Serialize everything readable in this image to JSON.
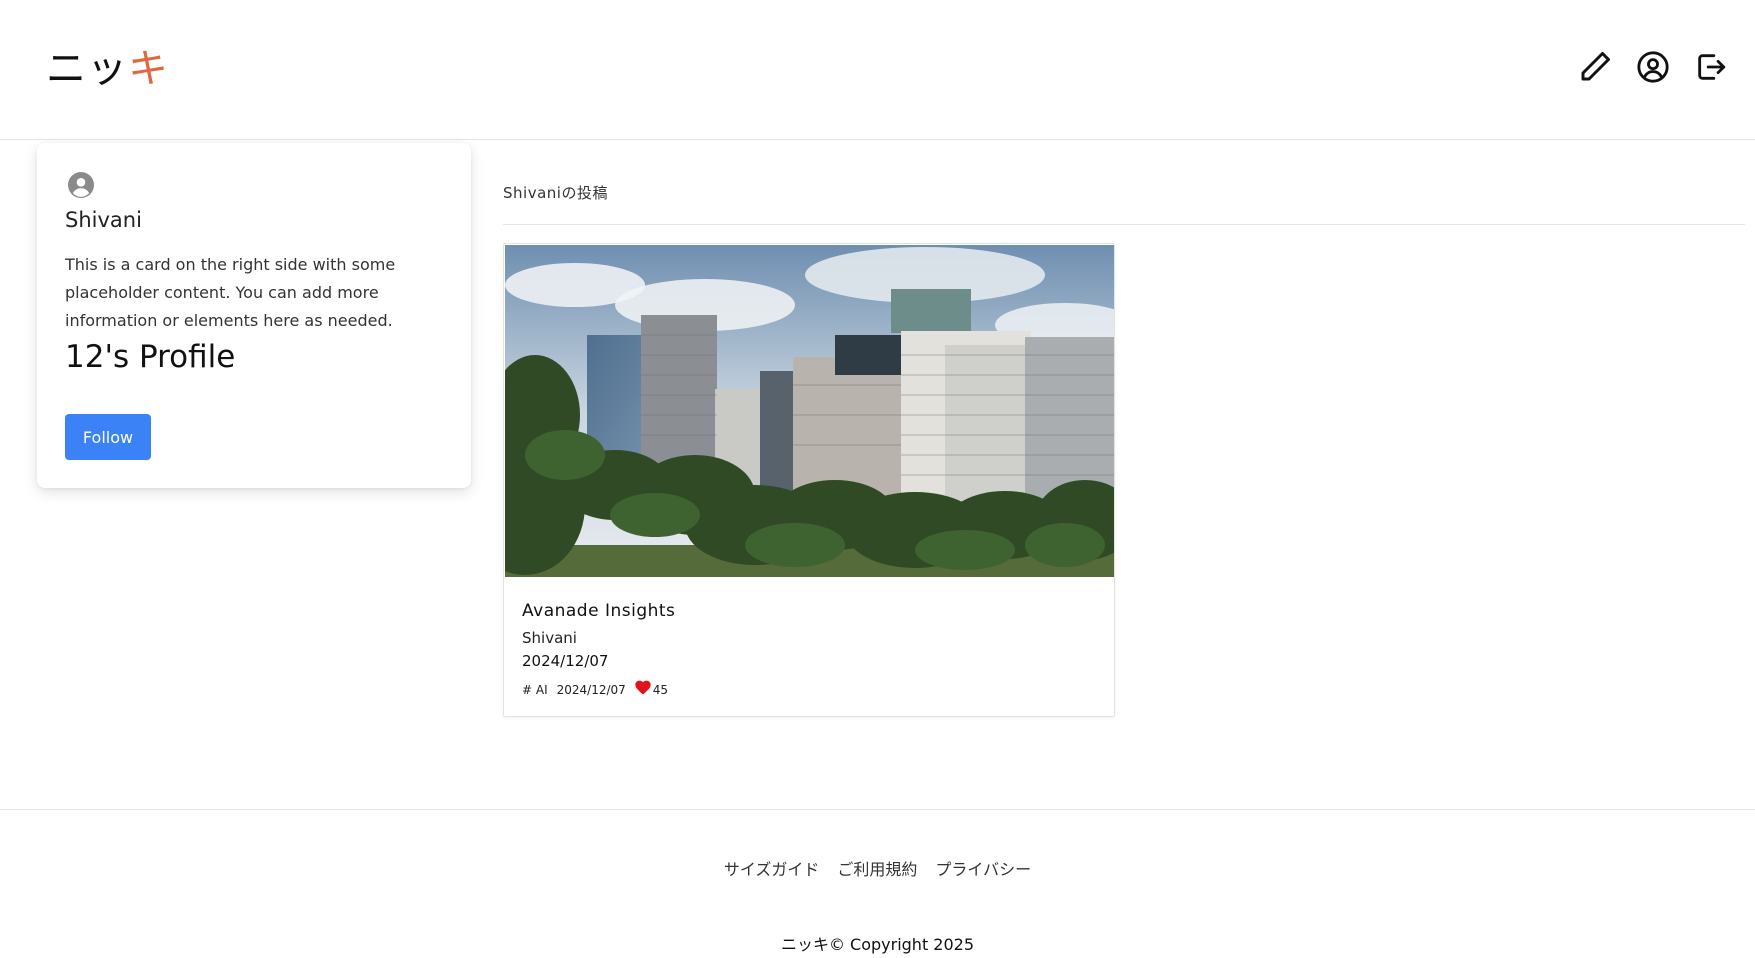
{
  "header": {
    "logo_main": "ニッ",
    "logo_accent": "キ",
    "icons": [
      "pencil-icon",
      "user-circle-icon",
      "logout-icon"
    ]
  },
  "profile": {
    "avatar_icon": "user-circle-icon",
    "name": "Shivani",
    "description": "This is a card on the right side with some placeholder content. You can add more information or elements here as needed.",
    "profile_title": "12's Profile",
    "follow_label": "Follow"
  },
  "posts": {
    "heading": "Shivaniの投稿",
    "items": [
      {
        "title": "Avanade Insights",
        "author": "Shivani",
        "date": "2024/12/07",
        "tag": "# AI",
        "meta_date": "2024/12/07",
        "likes": "45"
      }
    ]
  },
  "footer": {
    "links": [
      "サイズガイド",
      "ご利用規約",
      "プライバシー"
    ],
    "copyright": "ニッキ© Copyright 2025"
  },
  "colors": {
    "accent": "#e0683f",
    "button": "#3b82f6",
    "heart": "#e0131b"
  }
}
